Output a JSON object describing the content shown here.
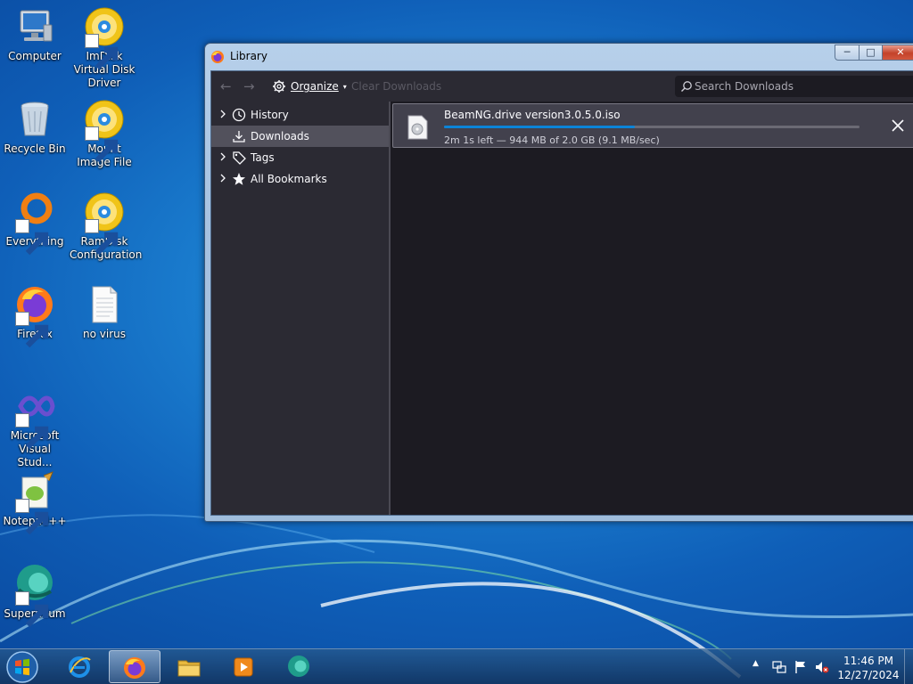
{
  "desktop": {
    "icons": [
      {
        "label": "Computer",
        "icon": "computer-icon",
        "shortcut": false
      },
      {
        "label": "ImDisk Virtual Disk Driver",
        "icon": "disc-icon",
        "shortcut": true
      },
      {
        "label": "Recycle Bin",
        "icon": "recycle-bin-icon",
        "shortcut": false
      },
      {
        "label": "Mount Image File",
        "icon": "disc-icon",
        "shortcut": true
      },
      {
        "label": "Everything",
        "icon": "everything-search-icon",
        "shortcut": true
      },
      {
        "label": "RamDisk Configuration",
        "icon": "disc-icon",
        "shortcut": true
      },
      {
        "label": "Firefox",
        "icon": "firefox-icon",
        "shortcut": true
      },
      {
        "label": "no virus",
        "icon": "text-file-icon",
        "shortcut": false
      },
      {
        "label": "Microsoft Visual Stud...",
        "icon": "visual-studio-icon",
        "shortcut": true
      },
      {
        "label": "Notepad++",
        "icon": "notepad-plus-plus-icon",
        "shortcut": true
      },
      {
        "label": "Supermium",
        "icon": "supermium-icon",
        "shortcut": true
      }
    ]
  },
  "window": {
    "title": "Library",
    "controls": {
      "minimize": "minimize",
      "maximize": "maximize",
      "close": "close"
    },
    "toolbar": {
      "back_icon": "back-arrow-icon",
      "forward_icon": "forward-arrow-icon",
      "organize_label": "Organize",
      "clear_downloads_label": "Clear Downloads",
      "search_placeholder": "Search Downloads",
      "search_value": ""
    },
    "sidebar": {
      "items": [
        {
          "label": "History",
          "icon": "clock-icon",
          "expandable": true,
          "selected": false
        },
        {
          "label": "Downloads",
          "icon": "download-icon",
          "expandable": false,
          "selected": true
        },
        {
          "label": "Tags",
          "icon": "tag-icon",
          "expandable": true,
          "selected": false
        },
        {
          "label": "All Bookmarks",
          "icon": "star-icon",
          "expandable": true,
          "selected": false
        }
      ]
    },
    "downloads": [
      {
        "filename": "BeamNG.drive version3.0.5.0.iso",
        "status": "2m 1s left — 944 MB of 2.0 GB (9.1 MB/sec)",
        "progress": 0.46
      }
    ]
  },
  "taskbar": {
    "pinned": [
      {
        "icon": "internet-explorer-icon",
        "active": false
      },
      {
        "icon": "firefox-icon",
        "active": true
      },
      {
        "icon": "file-explorer-icon",
        "active": false
      },
      {
        "icon": "media-player-icon",
        "active": false
      },
      {
        "icon": "supermium-icon",
        "active": false
      }
    ],
    "tray": {
      "icons": [
        "show-hidden-icons",
        "network-icon",
        "action-center-flag-icon",
        "volume-muted-icon"
      ]
    },
    "clock": {
      "time": "11:46 PM",
      "date": "12/27/2024"
    }
  },
  "colors": {
    "accent": "#0b84d8",
    "library_bg": "#1c1b22",
    "toolbar_bg": "#2b2a33",
    "selected_bg": "#52515c"
  }
}
